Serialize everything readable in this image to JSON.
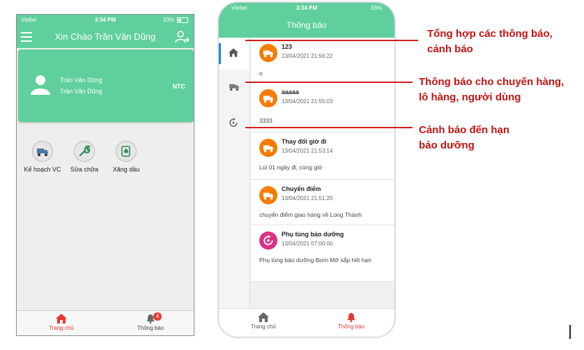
{
  "phone_home": {
    "status": {
      "carrier": "Viettel",
      "time": "3:34 PM",
      "battery": "33%"
    },
    "appbar": {
      "title": "Xin Chào Trần Văn Dũng"
    },
    "profile": {
      "name_line1": "Trần Văn Dũng",
      "name_line2": "Trần Văn Dũng",
      "company": "NTC"
    },
    "shortcuts": [
      {
        "label": "Kế hoạch VC",
        "icon": "truck-icon"
      },
      {
        "label": "Sửa chữa",
        "icon": "wrench-icon"
      },
      {
        "label": "Xăng dầu",
        "icon": "fuel-icon"
      }
    ],
    "bottom_nav": [
      {
        "label": "Trang chủ",
        "icon": "home-icon",
        "active": true
      },
      {
        "label": "Thông báo",
        "icon": "bell-icon",
        "badge": "4",
        "active": false
      }
    ]
  },
  "phone_notifications": {
    "status": {
      "carrier": "Viettel",
      "time": "3:34 PM",
      "battery": "33%"
    },
    "header": {
      "title": "Thông báo"
    },
    "sidebar": [
      {
        "icon": "home-icon",
        "active": true
      },
      {
        "icon": "truck-icon",
        "active": false
      },
      {
        "icon": "maintenance-icon",
        "active": false
      }
    ],
    "notifications": [
      {
        "title": "123",
        "time": "13/04/2021 21:56:22",
        "body": "o",
        "icon": "truck-icon",
        "color": "#f57c00"
      },
      {
        "title": "aaaaa",
        "time": "13/04/2021 21:55:03",
        "body": "3333",
        "icon": "truck-icon",
        "color": "#f57c00"
      },
      {
        "title": "Thay đổi giờ đi",
        "time": "13/04/2021 21:53:14",
        "body": "Lùi 01 ngày đi, cùng giờ",
        "icon": "truck-icon",
        "color": "#f57c00"
      },
      {
        "title": "Chuyển điểm",
        "time": "13/04/2021 21:51:20",
        "body": "chuyển điểm giao hàng về Long Thành",
        "icon": "truck-icon",
        "color": "#f57c00"
      },
      {
        "title": "Phụ tùng bảo dưỡng",
        "time": "13/04/2021 07:00:00",
        "body": "Phụ tùng bảo dưỡng Bơm Mỡ sắp hết hạn",
        "icon": "maintenance-icon",
        "color": "#d63384"
      }
    ],
    "bottom_nav": [
      {
        "label": "Trang chủ",
        "icon": "home-icon",
        "active": false
      },
      {
        "label": "Thông báo",
        "icon": "bell-icon",
        "active": true
      }
    ]
  },
  "annotations": [
    {
      "text_line1": "Tổng hợp các thông báo,",
      "text_line2": "cảnh báo"
    },
    {
      "text_line1": "Thông báo cho chuyến hàng,",
      "text_line2": "lô hàng, người dùng"
    },
    {
      "text_line1": "Cảnh báo đến hạn",
      "text_line2": "bảo dưỡng"
    }
  ],
  "colors": {
    "primary": "#5fcf9d",
    "accent_orange": "#f57c00",
    "accent_pink": "#d63384",
    "annotation_red": "#d11d1d",
    "active_red": "#e53935"
  }
}
